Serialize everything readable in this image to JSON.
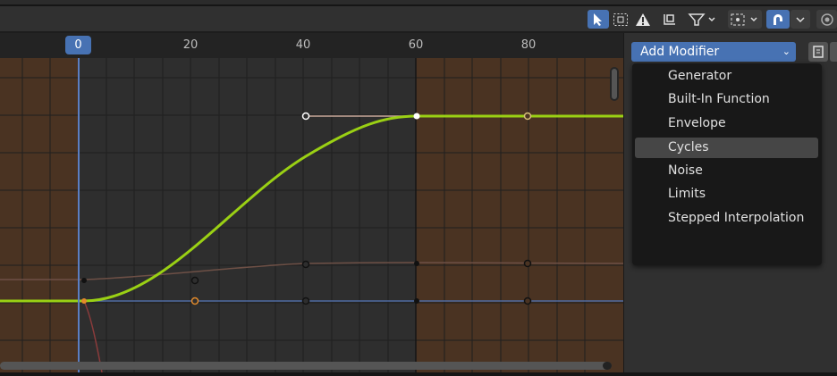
{
  "ruler": {
    "current_frame": "0",
    "labels": [
      "20",
      "40",
      "60",
      "80"
    ]
  },
  "header_icons": [
    "select-cursor-icon",
    "select-box-icon",
    "warning-icon",
    "pivot-icon",
    "filter-icon",
    "proportional-icon",
    "snap-icon"
  ],
  "sidebar": {
    "add_modifier_label": "Add Modifier",
    "menu_items": [
      {
        "label": "Generator",
        "highlighted": false
      },
      {
        "label": "Built-In Function",
        "highlighted": false
      },
      {
        "label": "Envelope",
        "highlighted": false
      },
      {
        "label": "Cycles",
        "highlighted": true
      },
      {
        "label": "Noise",
        "highlighted": false
      },
      {
        "label": "Limits",
        "highlighted": false
      },
      {
        "label": "Stepped Interpolation",
        "highlighted": false
      }
    ]
  },
  "colors": {
    "accent": "#4772b3",
    "curve_selected": "#9ad014",
    "outside_range": "#4a3322",
    "curve_x": "#6e5046",
    "curve_y": "#4f6aa0"
  }
}
